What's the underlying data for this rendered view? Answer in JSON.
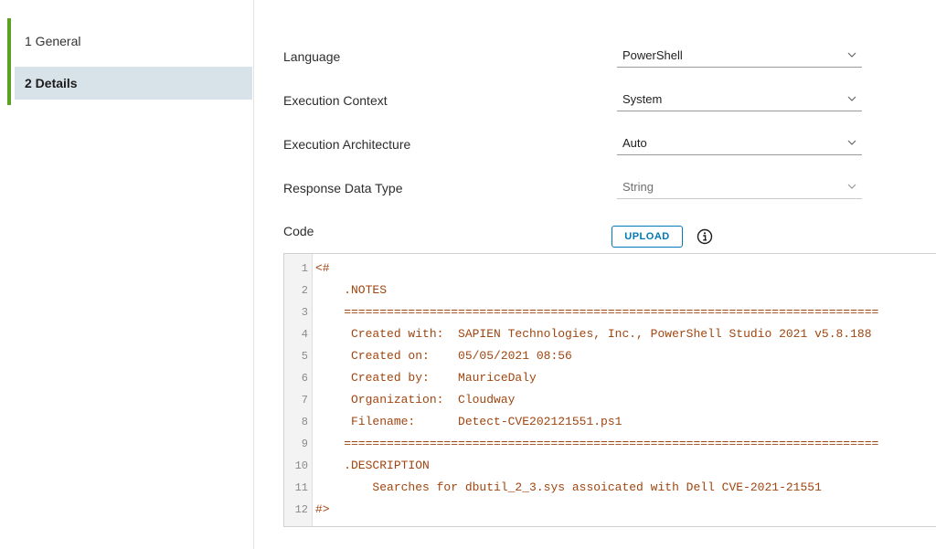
{
  "sidebar": {
    "steps": [
      {
        "label": "1 General"
      },
      {
        "label": "2 Details"
      }
    ]
  },
  "form": {
    "fields": [
      {
        "label": "Language",
        "value": "PowerShell"
      },
      {
        "label": "Execution Context",
        "value": "System"
      },
      {
        "label": "Execution Architecture",
        "value": "Auto"
      },
      {
        "label": "Response Data Type",
        "value": "String"
      }
    ],
    "code_label": "Code",
    "upload_label": "UPLOAD"
  },
  "editor": {
    "lines": [
      {
        "n": "1",
        "text": "<#"
      },
      {
        "n": "2",
        "text": "    .NOTES"
      },
      {
        "n": "3",
        "text": "    ==========================================================================="
      },
      {
        "n": "4",
        "text": "     Created with:  SAPIEN Technologies, Inc., PowerShell Studio 2021 v5.8.188"
      },
      {
        "n": "5",
        "text": "     Created on:    05/05/2021 08:56"
      },
      {
        "n": "6",
        "text": "     Created by:    MauriceDaly"
      },
      {
        "n": "7",
        "text": "     Organization:  Cloudway"
      },
      {
        "n": "8",
        "text": "     Filename:      Detect-CVE202121551.ps1"
      },
      {
        "n": "9",
        "text": "    ==========================================================================="
      },
      {
        "n": "10",
        "text": "    .DESCRIPTION"
      },
      {
        "n": "11",
        "text": "        Searches for dbutil_2_3.sys assoicated with Dell CVE-2021-21551"
      },
      {
        "n": "12",
        "text": "#>"
      }
    ]
  },
  "colors": {
    "accent_green": "#5aa220",
    "selected_step_bg": "#d8e3e9",
    "upload_blue": "#0079b8",
    "code_text": "#a0450f"
  }
}
